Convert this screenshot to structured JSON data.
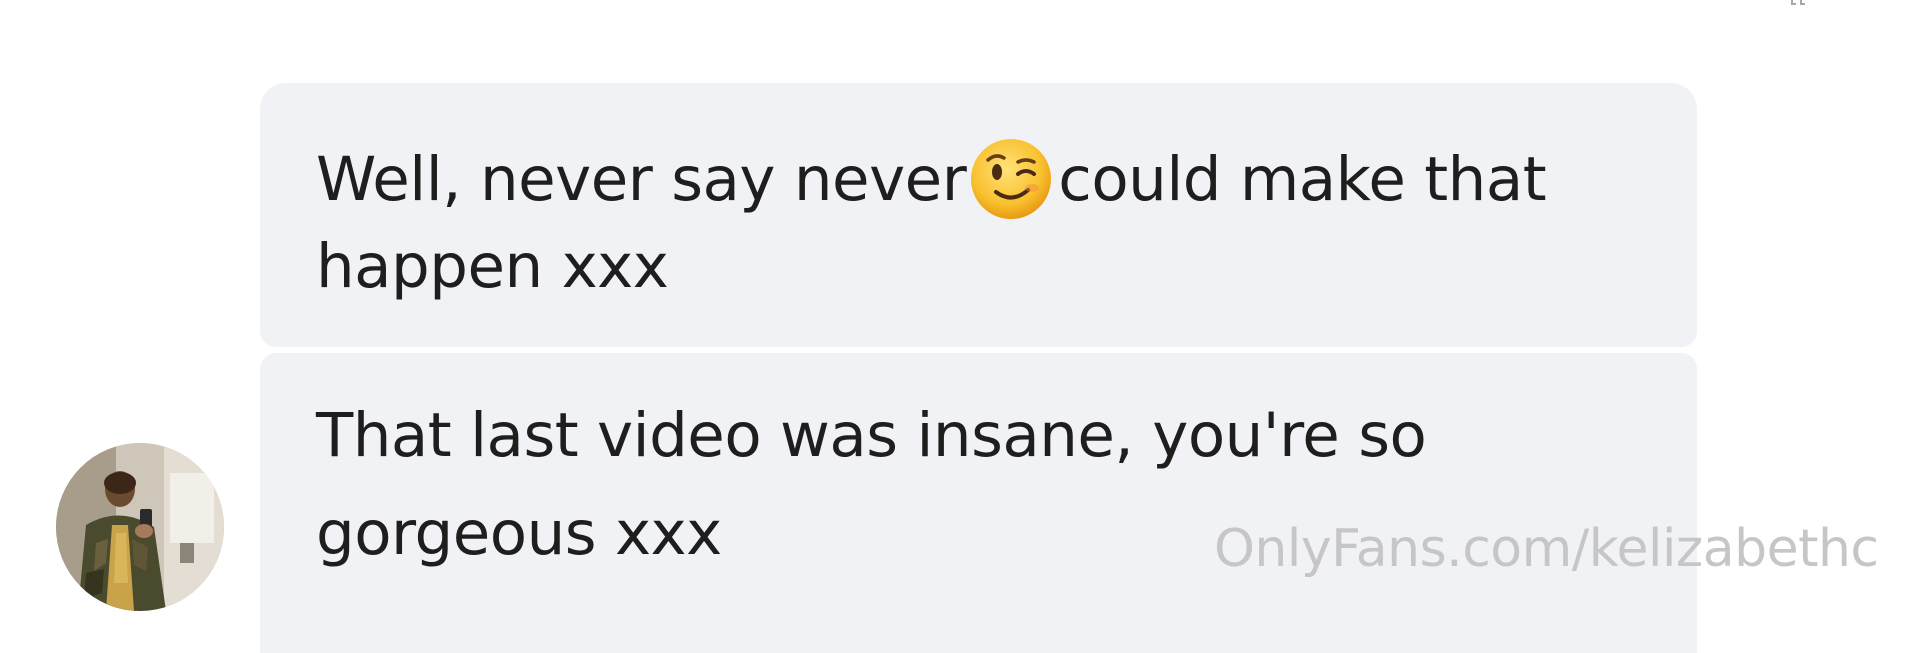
{
  "messages": [
    {
      "lines": [
        "Well, never say never",
        "could make that",
        "happen xxx"
      ],
      "emoji": "winking-face-emoji"
    },
    {
      "lines": [
        "That last video was insane, you're so",
        "gorgeous xxx"
      ]
    }
  ],
  "watermark": "OnlyFans.com/kelizabethc",
  "avatar_icon": "profile-photo-avatar",
  "colors": {
    "bubble_background": "#f1f2f5",
    "message_text": "#1e1e1e",
    "watermark_text": "#c6c6c9",
    "page_background": "#ffffff"
  }
}
